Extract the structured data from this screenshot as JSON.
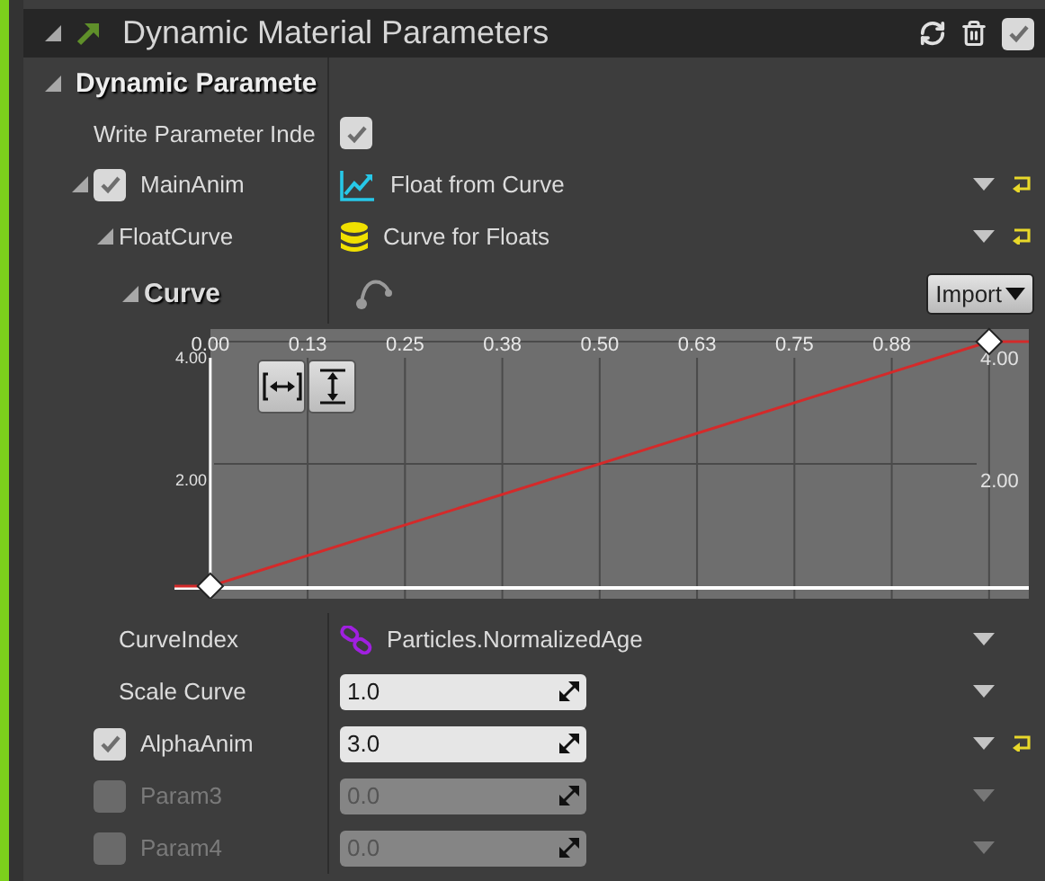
{
  "panel": {
    "title": "Dynamic Material Parameters",
    "expanded": true,
    "enabled": true
  },
  "section": {
    "title": "Dynamic Paramete",
    "expanded": true
  },
  "rows": [
    {
      "kind": "toggle",
      "label": "Write Parameter Inde",
      "checked": true
    },
    {
      "kind": "module",
      "label": "MainAnim",
      "checked": true,
      "expanded": true,
      "value": "Float from Curve",
      "resettable": true,
      "children": [
        {
          "kind": "asset",
          "label": "FloatCurve",
          "expanded": true,
          "value": "Curve for Floats",
          "resettable": true,
          "children": [
            {
              "kind": "curve",
              "label": "Curve",
              "expanded": true,
              "import_button": "Import",
              "chart_data": {
                "type": "line",
                "grid": true,
                "x": [
                  -0.046,
                  0,
                  1,
                  1.051
                ],
                "series": [
                  {
                    "color": "#d42a2a",
                    "marker": "diamond",
                    "values": [
                      0,
                      0,
                      4,
                      4
                    ]
                  }
                ],
                "xlim": [
                  -0.046,
                  1.051
                ],
                "ylim": [
                  0,
                  4
                ],
                "xticks": [
                  {
                    "value": 0,
                    "label": "0.00"
                  },
                  {
                    "value": 0.125,
                    "label": "0.13"
                  },
                  {
                    "value": 0.25,
                    "label": "0.25"
                  },
                  {
                    "value": 0.375,
                    "label": "0.38"
                  },
                  {
                    "value": 0.5,
                    "label": "0.50"
                  },
                  {
                    "value": 0.625,
                    "label": "0.63"
                  },
                  {
                    "value": 0.75,
                    "label": "0.75"
                  },
                  {
                    "value": 0.875,
                    "label": "0.88"
                  }
                ],
                "yticks": [
                  {
                    "value": 2,
                    "label": "2.00"
                  },
                  {
                    "value": 4,
                    "label": "4.00"
                  }
                ]
              }
            }
          ]
        },
        {
          "kind": "binding",
          "label": "CurveIndex",
          "value": "Particles.NormalizedAge",
          "resettable": false
        },
        {
          "kind": "number",
          "label": "Scale Curve",
          "value": "1.0",
          "resettable": false
        }
      ]
    },
    {
      "kind": "param",
      "label": "AlphaAnim",
      "checked": true,
      "value": "3.0",
      "resettable": true
    },
    {
      "kind": "param",
      "label": "Param3",
      "checked": false,
      "value": "0.0",
      "resettable": false
    },
    {
      "kind": "param",
      "label": "Param4",
      "checked": false,
      "value": "0.0",
      "resettable": false
    }
  ]
}
